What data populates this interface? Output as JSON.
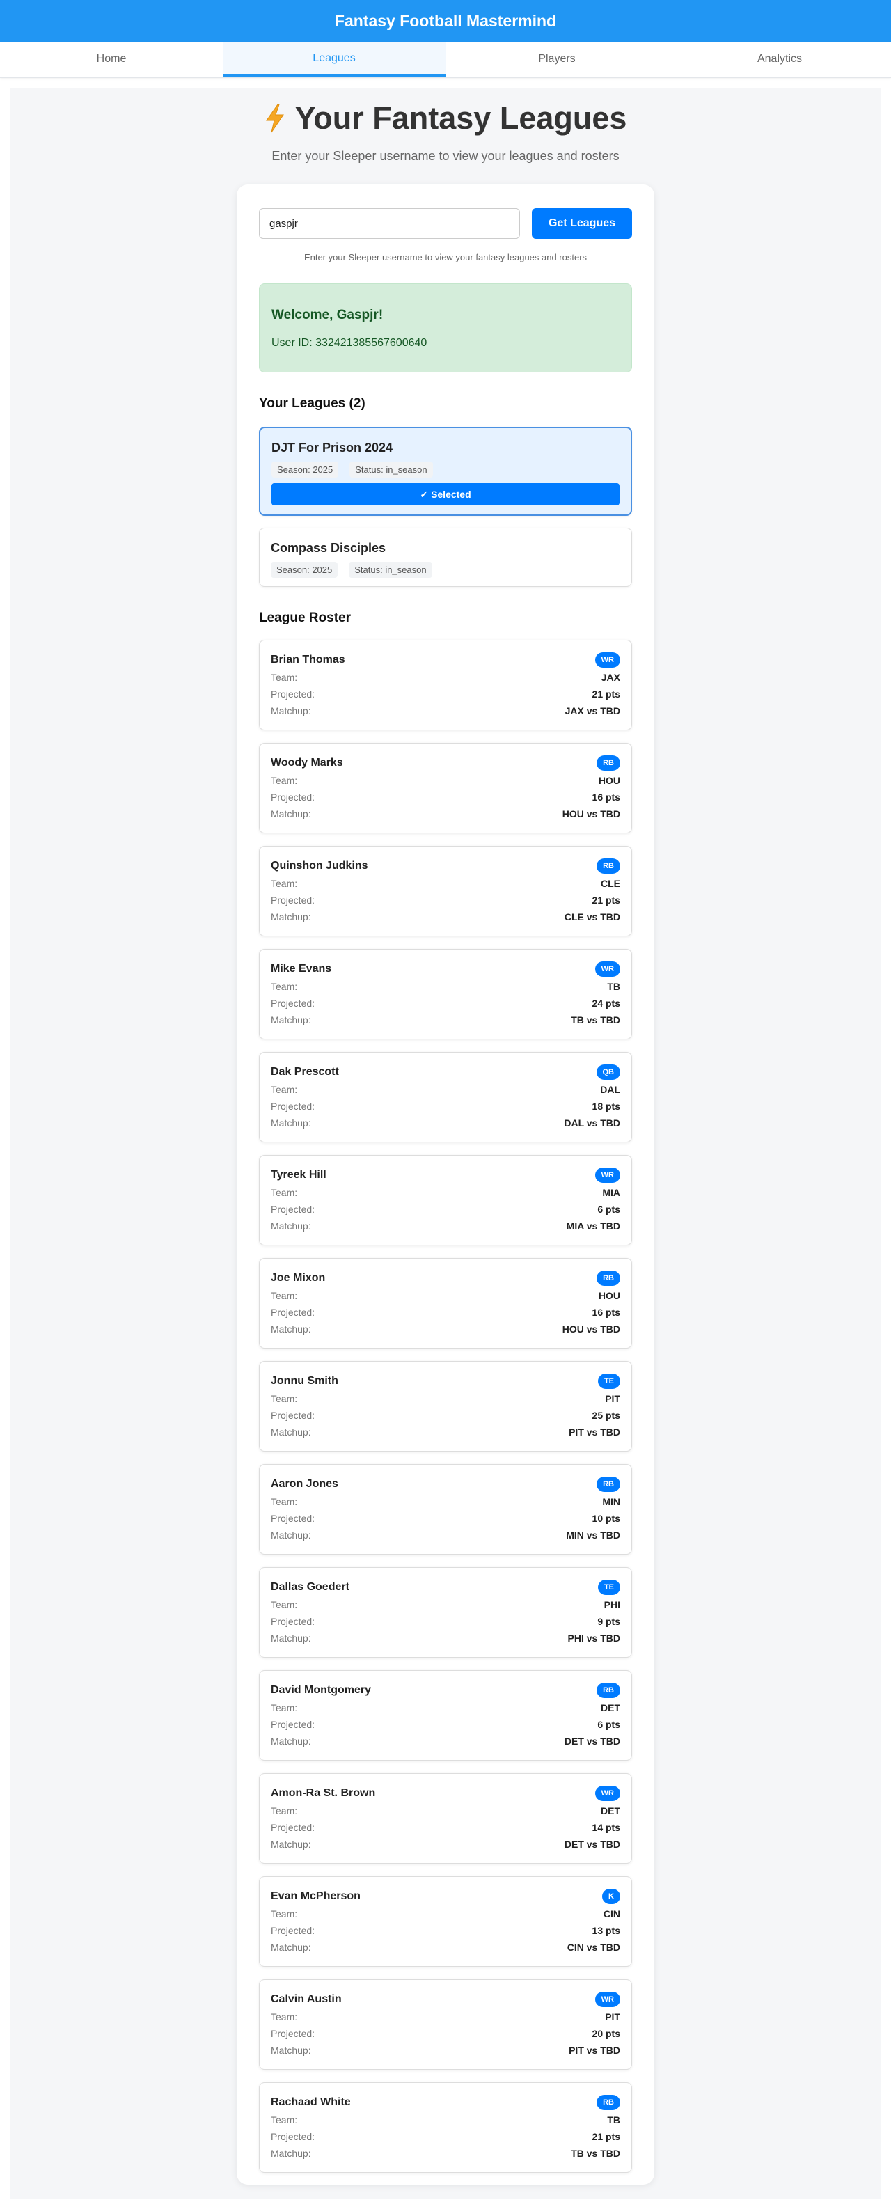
{
  "app": {
    "title": "Fantasy Football Mastermind"
  },
  "nav": {
    "tabs": [
      {
        "label": "Home"
      },
      {
        "label": "Leagues"
      },
      {
        "label": "Players"
      },
      {
        "label": "Analytics"
      }
    ],
    "active": "Leagues"
  },
  "hero": {
    "title": "Your Fantasy Leagues",
    "subtitle": "Enter your Sleeper username to view your leagues and rosters"
  },
  "search": {
    "value": "gaspjr",
    "button": "Get Leagues",
    "hint": "Enter your Sleeper username to view your fantasy leagues and rosters"
  },
  "welcome": {
    "title": "Welcome, Gaspjr!",
    "user_id": "User ID: 332421385567600640"
  },
  "leagues": {
    "heading": "Your Leagues (2)",
    "items": [
      {
        "name": "DJT For Prison 2024",
        "season": "Season: 2025",
        "status": "Status: in_season",
        "selected_label": "Selected"
      },
      {
        "name": "Compass Disciples",
        "season": "Season: 2025",
        "status": "Status: in_season"
      }
    ]
  },
  "roster": {
    "heading": "League Roster",
    "labels": {
      "team": "Team:",
      "projected": "Projected:",
      "matchup": "Matchup:"
    },
    "players": [
      {
        "name": "Brian Thomas",
        "pos": "WR",
        "team": "JAX",
        "projected": "21 pts",
        "matchup": "JAX vs TBD"
      },
      {
        "name": "Woody Marks",
        "pos": "RB",
        "team": "HOU",
        "projected": "16 pts",
        "matchup": "HOU vs TBD"
      },
      {
        "name": "Quinshon Judkins",
        "pos": "RB",
        "team": "CLE",
        "projected": "21 pts",
        "matchup": "CLE vs TBD"
      },
      {
        "name": "Mike Evans",
        "pos": "WR",
        "team": "TB",
        "projected": "24 pts",
        "matchup": "TB vs TBD"
      },
      {
        "name": "Dak Prescott",
        "pos": "QB",
        "team": "DAL",
        "projected": "18 pts",
        "matchup": "DAL vs TBD"
      },
      {
        "name": "Tyreek Hill",
        "pos": "WR",
        "team": "MIA",
        "projected": "6 pts",
        "matchup": "MIA vs TBD"
      },
      {
        "name": "Joe Mixon",
        "pos": "RB",
        "team": "HOU",
        "projected": "16 pts",
        "matchup": "HOU vs TBD"
      },
      {
        "name": "Jonnu Smith",
        "pos": "TE",
        "team": "PIT",
        "projected": "25 pts",
        "matchup": "PIT vs TBD"
      },
      {
        "name": "Aaron Jones",
        "pos": "RB",
        "team": "MIN",
        "projected": "10 pts",
        "matchup": "MIN vs TBD"
      },
      {
        "name": "Dallas Goedert",
        "pos": "TE",
        "team": "PHI",
        "projected": "9 pts",
        "matchup": "PHI vs TBD"
      },
      {
        "name": "David Montgomery",
        "pos": "RB",
        "team": "DET",
        "projected": "6 pts",
        "matchup": "DET vs TBD"
      },
      {
        "name": "Amon-Ra St. Brown",
        "pos": "WR",
        "team": "DET",
        "projected": "14 pts",
        "matchup": "DET vs TBD"
      },
      {
        "name": "Evan McPherson",
        "pos": "K",
        "team": "CIN",
        "projected": "13 pts",
        "matchup": "CIN vs TBD"
      },
      {
        "name": "Calvin Austin",
        "pos": "WR",
        "team": "PIT",
        "projected": "20 pts",
        "matchup": "PIT vs TBD"
      },
      {
        "name": "Rachaad White",
        "pos": "RB",
        "team": "TB",
        "projected": "21 pts",
        "matchup": "TB vs TBD"
      }
    ]
  },
  "colors": {
    "header": "#2196f3",
    "accent": "#007bff",
    "welcome_bg": "#d4edda",
    "selected_bg": "#e6f2ff"
  }
}
